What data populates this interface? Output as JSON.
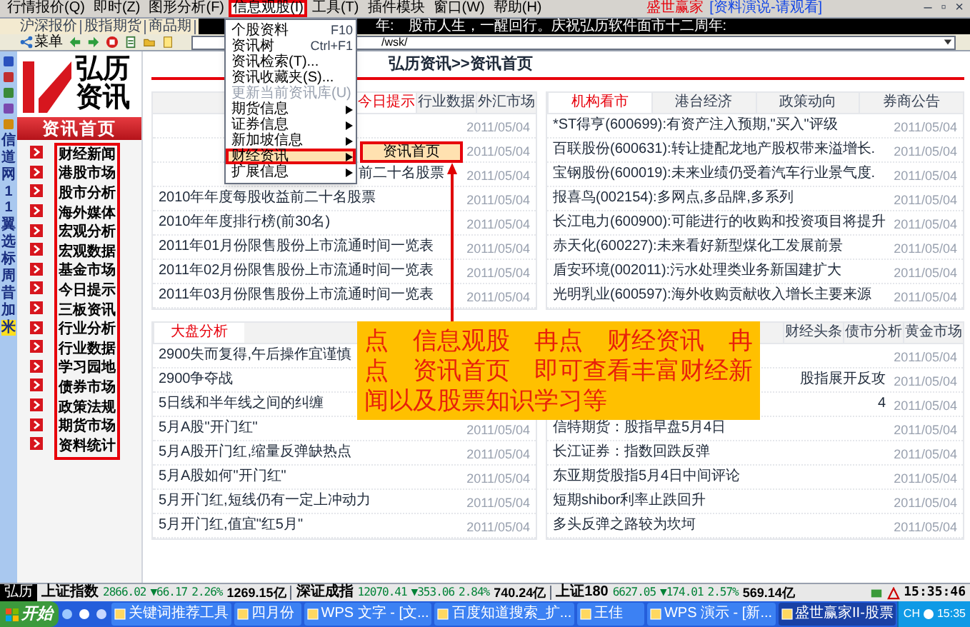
{
  "menu_bar": {
    "items": [
      {
        "label": "行情报价(Q)",
        "selected": false
      },
      {
        "label": "即时(Z)",
        "selected": false
      },
      {
        "label": "图形分析(F)",
        "selected": false
      },
      {
        "label": "信息观股(I)",
        "selected": true
      },
      {
        "label": "工具(T)",
        "selected": false
      },
      {
        "label": "插件模块",
        "selected": false
      },
      {
        "label": "窗口(W)",
        "selected": false
      },
      {
        "label": "帮助(H)",
        "selected": false
      }
    ],
    "title": "盛世赢家",
    "subtitle": "[资料演说-请观看]",
    "controls": [
      "–",
      "▫",
      "×"
    ]
  },
  "quote_tabs": [
    "沪深报价",
    "股指期货",
    "商品期"
  ],
  "ticker": {
    "prefix": "年:",
    "text": "股市人生，一醒回行。庆祝弘历软件面市十二周年:"
  },
  "toolbar": {
    "menu_label": "菜单",
    "address": "/wsk/"
  },
  "vertical_tabs": [
    {
      "label": "信",
      "selected": false
    },
    {
      "label": "道",
      "selected": false
    },
    {
      "label": "网",
      "selected": false
    },
    {
      "label": "11",
      "selected": false
    },
    {
      "label": "翼",
      "selected": false
    },
    {
      "label": "选",
      "selected": false
    },
    {
      "label": "标",
      "selected": false
    },
    {
      "label": "周",
      "selected": false
    },
    {
      "label": "昔",
      "selected": false
    },
    {
      "label": "加",
      "selected": false
    },
    {
      "label": "米",
      "selected": true
    }
  ],
  "sidebar": {
    "logo_top": "弘历",
    "logo_bottom": "资讯",
    "header": "资讯首页",
    "items": [
      "财经新闻",
      "港股市场",
      "股市分析",
      "海外媒体",
      "宏观分析",
      "宏观数据",
      "基金市场",
      "今日提示",
      "三板资讯",
      "行业分析",
      "行业数据",
      "学习园地",
      "债券市场",
      "政策法规",
      "期货市场",
      "资料统计"
    ]
  },
  "breadcrumb": "弘历资讯>>资讯首页",
  "panels": [
    {
      "kind": "end",
      "tabs": [
        {
          "label": "今日提示",
          "selected": true
        },
        {
          "label": "行业数据",
          "selected": false
        },
        {
          "label": "外汇市场",
          "selected": false
        }
      ],
      "rows": [
        {
          "kind": "cut",
          "date": "2011/05/04"
        },
        {
          "kind": "cut",
          "date": "2011/05/04"
        },
        {
          "kind": "cut",
          "title": "前二十名股票",
          "date": "2011/05/04"
        },
        {
          "kind": "full",
          "title": "2010年年度每股收益前二十名股票",
          "date": "2011/05/04"
        },
        {
          "kind": "full",
          "title": "2010年年度排行榜(前30名)",
          "date": "2011/05/04"
        },
        {
          "kind": "full",
          "title": "2011年01月份限售股份上市流通时间一览表",
          "date": "2011/05/04"
        },
        {
          "kind": "full",
          "title": "2011年02月份限售股份上市流通时间一览表",
          "date": "2011/05/04"
        },
        {
          "kind": "full",
          "title": "2011年03月份限售股份上市流通时间一览表",
          "date": "2011/05/04"
        }
      ]
    },
    {
      "kind": "fill",
      "tabs": [
        {
          "label": "机构看市",
          "selected": true
        },
        {
          "label": "港台经济",
          "selected": false
        },
        {
          "label": "政策动向",
          "selected": false
        },
        {
          "label": "券商公告",
          "selected": false
        }
      ],
      "rows": [
        {
          "kind": "full",
          "title": "*ST得亨(600699):有资产注入预期,\"买入\"评级",
          "date": "2011/05/04"
        },
        {
          "kind": "full",
          "title": "百联股份(600631):转让捷配龙地产股权带来溢增长.",
          "date": "2011/05/04"
        },
        {
          "kind": "full",
          "title": "宝钢股份(600019):未来业绩仍受着汽车行业景气度.",
          "date": "2011/05/04"
        },
        {
          "kind": "full",
          "title": "报喜鸟(002154):多网点,多品牌,多系列",
          "date": "2011/05/04"
        },
        {
          "kind": "full",
          "title": "长江电力(600900):可能进行的收购和投资项目将提升",
          "date": "2011/05/04"
        },
        {
          "kind": "full",
          "title": "赤天化(600227):未来看好新型煤化工发展前景",
          "date": "2011/05/04"
        },
        {
          "kind": "full",
          "title": "盾安环境(002011):污水处理类业务新国建扩大",
          "date": "2011/05/04"
        },
        {
          "kind": "full",
          "title": "光明乳业(600597):海外收购贡献收入增长主要来源",
          "date": "2011/05/04"
        }
      ]
    },
    {
      "kind": "start",
      "tabs": [
        {
          "label": "大盘分析",
          "selected": true
        }
      ],
      "rows": [
        {
          "kind": "full",
          "title": "2900失而复得,午后操作宜谨慎"
        },
        {
          "kind": "full",
          "title": "2900争夺战"
        },
        {
          "kind": "full",
          "title": "5日线和半年线之间的纠缠"
        },
        {
          "kind": "full",
          "title": "5月A股\"开门红\"",
          "date": "2011/05/04"
        },
        {
          "kind": "full",
          "title": "5月A股开门红,缩量反弹缺热点",
          "date": "2011/05/04"
        },
        {
          "kind": "full",
          "title": "5月A股如何\"开门红\"",
          "date": "2011/05/04"
        },
        {
          "kind": "full",
          "title": "5月开门红,短线仍有一定上冲动力",
          "date": "2011/05/04"
        },
        {
          "kind": "full",
          "title": "5月开门红,值宜\"红5月\"",
          "date": "2011/05/04"
        }
      ]
    },
    {
      "kind": "end",
      "tabs": [
        {
          "label": "财经头条",
          "selected": false
        },
        {
          "label": "债市分析",
          "selected": false
        },
        {
          "label": "黄金市场",
          "selected": false
        }
      ],
      "rows": [
        {
          "kind": "cut",
          "date": "2011/05/04"
        },
        {
          "kind": "cut",
          "title": "股指展开反攻",
          "date": "2011/05/04"
        },
        {
          "kind": "cut",
          "title": "4",
          "date": "2011/05/04"
        },
        {
          "kind": "full",
          "title": "信特期货：股指早盘5月4日",
          "date": "2011/05/04"
        },
        {
          "kind": "full",
          "title": "长江证券：指数回跌反弹",
          "date": "2011/05/04"
        },
        {
          "kind": "full",
          "title": "东亚期货股指5月4日中间评论",
          "date": "2011/05/04"
        },
        {
          "kind": "full",
          "title": "短期shibor利率止跌回升",
          "date": "2011/05/04"
        },
        {
          "kind": "full",
          "title": "多头反弹之路较为坎坷",
          "date": "2011/05/04"
        }
      ]
    }
  ],
  "dropdown": {
    "items": [
      {
        "label": "个股资料",
        "shortcut": "F10",
        "kind": "command",
        "disabled": false,
        "selected": false
      },
      {
        "label": "资讯树",
        "shortcut": "Ctrl+F1",
        "kind": "command",
        "disabled": false,
        "selected": false
      },
      {
        "label": "资讯检索(T)...",
        "kind": "command",
        "disabled": false,
        "selected": false
      },
      {
        "label": "资讯收藏夹(S)...",
        "kind": "command",
        "disabled": false,
        "selected": false
      },
      {
        "label": "更新当前资讯库(U)",
        "kind": "command",
        "disabled": true,
        "selected": false
      },
      {
        "label": "期货信息",
        "kind": "submenu",
        "disabled": false,
        "selected": false
      },
      {
        "label": "证券信息",
        "kind": "submenu",
        "disabled": false,
        "selected": false
      },
      {
        "label": "新加坡信息",
        "kind": "submenu",
        "disabled": false,
        "selected": false
      },
      {
        "label": "财经资讯",
        "kind": "submenu",
        "disabled": false,
        "selected": true
      },
      {
        "label": "扩展信息",
        "kind": "submenu",
        "disabled": false,
        "selected": false
      }
    ]
  },
  "submenu": {
    "items": [
      {
        "label": "资讯首页",
        "selected": true
      }
    ]
  },
  "callout": {
    "text": "点　信息观股　冉点　财经资讯　冉点　资讯首页　即可查看丰富财经新闻以及股票知识学习等"
  },
  "status_bar": {
    "label": "弘历",
    "indices": [
      {
        "name": "上证指数",
        "value": "2866.02",
        "change": "▼66.17",
        "percent": "2.26%",
        "amount": "1269.15亿"
      },
      {
        "name": "深证成指",
        "value": "12070.41",
        "change": "▼353.06",
        "percent": "2.84%",
        "amount": "740.24亿"
      },
      {
        "name": "上证180",
        "value": "6627.05",
        "change": "▼174.01",
        "percent": "2.57%",
        "amount": "569.14亿"
      }
    ],
    "time": "15:35:46"
  },
  "taskbar": {
    "start": "开始",
    "tasks": [
      {
        "label": "关键词推荐工具",
        "selected": false
      },
      {
        "label": "四月份",
        "selected": false
      },
      {
        "label": "WPS 文字 - [文...",
        "selected": false
      },
      {
        "label": "百度知道搜索_扩...",
        "selected": false
      },
      {
        "label": "王佳",
        "selected": false
      },
      {
        "label": "WPS 演示 - [新...",
        "selected": false
      },
      {
        "label": "盛世赢家II-股票",
        "selected": true
      }
    ],
    "language": "CH",
    "time": "15:35"
  }
}
